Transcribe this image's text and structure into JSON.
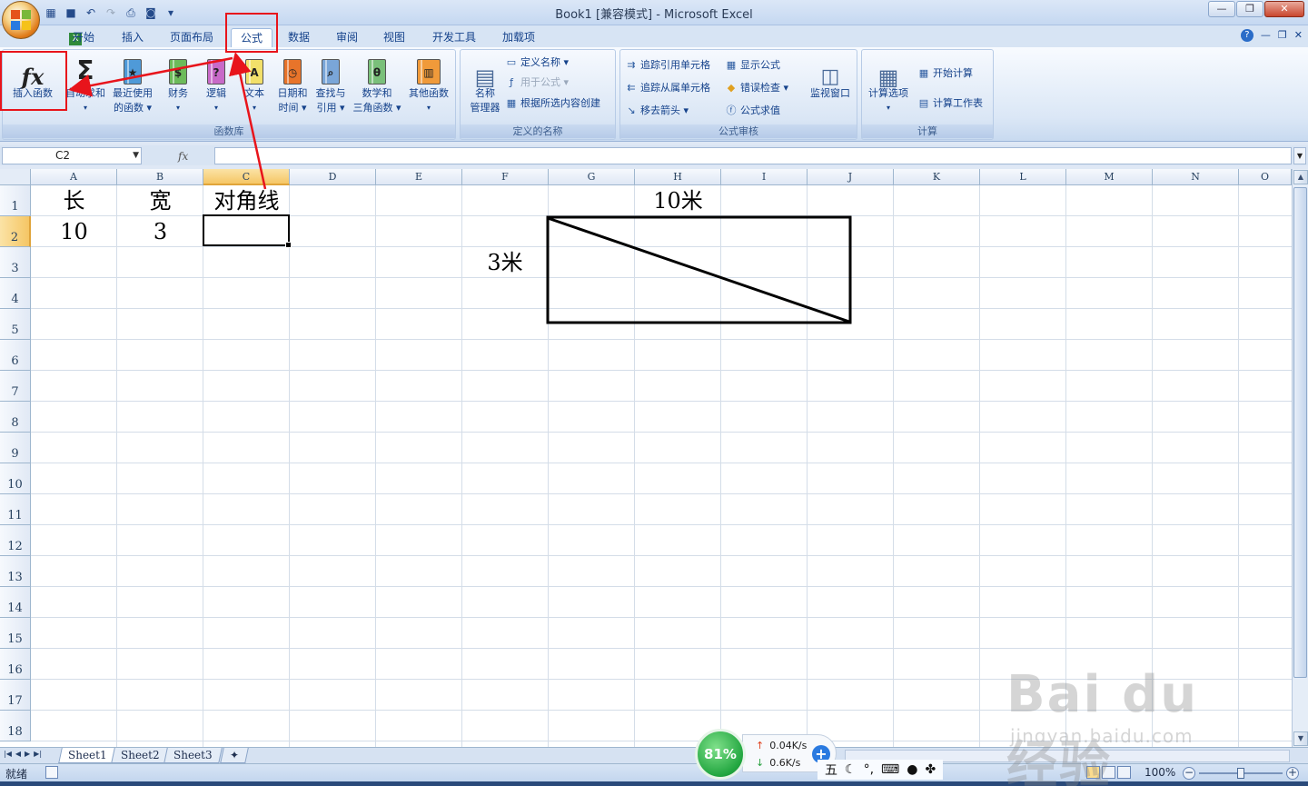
{
  "window": {
    "title": "Book1  [兼容模式] - Microsoft Excel",
    "controls": [
      "minimize",
      "restore",
      "close"
    ]
  },
  "ribbon_tabs": [
    "开始",
    "插入",
    "页面布局",
    "公式",
    "数据",
    "审阅",
    "视图",
    "开发工具",
    "加载项"
  ],
  "active_tab": "公式",
  "function_library": {
    "label": "函数库",
    "insert_function": "插入函数",
    "autosum": "自动求和",
    "recent_line1": "最近使用",
    "recent_line2": "的函数",
    "financial": "财务",
    "logical": "逻辑",
    "text": "文本",
    "datetime_line1": "日期和",
    "datetime_line2": "时间",
    "lookup_line1": "查找与",
    "lookup_line2": "引用",
    "math_line1": "数学和",
    "math_line2": "三角函数",
    "more": "其他函数"
  },
  "defined_names": {
    "label": "定义的名称",
    "name_manager_line1": "名称",
    "name_manager_line2": "管理器",
    "define_name": "定义名称",
    "use_in_formula": "用于公式",
    "create_from_selection": "根据所选内容创建"
  },
  "formula_auditing": {
    "label": "公式审核",
    "trace_precedents": "追踪引用单元格",
    "trace_dependents": "追踪从属单元格",
    "remove_arrows": "移去箭头",
    "show_formulas": "显示公式",
    "error_checking": "错误检查",
    "evaluate_formula": "公式求值",
    "watch_window": "监视窗口"
  },
  "calculation": {
    "label": "计算",
    "options": "计算选项",
    "calc_now": "开始计算",
    "calc_sheet": "计算工作表"
  },
  "formula_bar": {
    "name_box": "C2",
    "fx": "fx",
    "formula": ""
  },
  "columns": [
    "A",
    "B",
    "C",
    "D",
    "E",
    "F",
    "G",
    "H",
    "I",
    "J",
    "K",
    "L",
    "M",
    "N",
    "O"
  ],
  "selected_column": "C",
  "rows": [
    "1",
    "2",
    "3",
    "4",
    "5",
    "6",
    "7",
    "8",
    "9",
    "10",
    "11",
    "12",
    "13",
    "14",
    "15",
    "16",
    "17",
    "18"
  ],
  "selected_row": "2",
  "cells": {
    "A1": "长",
    "B1": "宽",
    "C1": "对角线",
    "A2": "10",
    "B2": "3",
    "C2": ""
  },
  "diagram": {
    "top_label": "10米",
    "side_label": "3米"
  },
  "sheets": [
    "Sheet1",
    "Sheet2",
    "Sheet3"
  ],
  "active_sheet": "Sheet1",
  "status": {
    "ready": "就绪",
    "zoom": "100%"
  },
  "netmon": {
    "percent": "81%",
    "upload": "0.04K/s",
    "download": "0.6K/s"
  },
  "ime": {
    "mode": "五"
  },
  "watermark": {
    "brand": "Bai du 经验",
    "url": "jingyan.baidu.com"
  },
  "colors": {
    "highlight": "#e8141b",
    "ribbon_text": "#15428b"
  }
}
